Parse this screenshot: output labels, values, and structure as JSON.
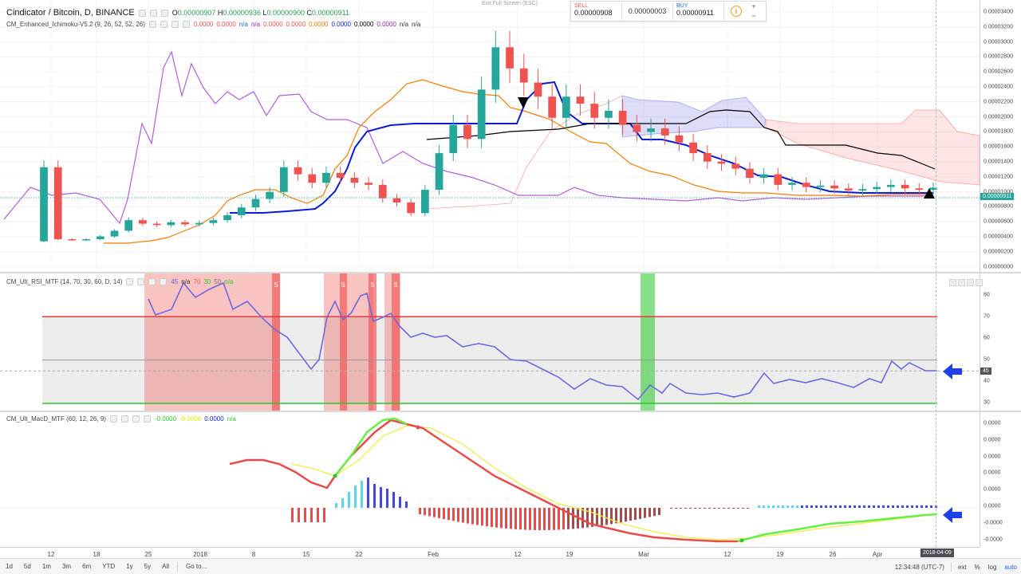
{
  "header": {
    "symbol_title": "Cindicator / Bitcoin, D, BINANCE",
    "open_label": "O",
    "open": "0.00000907",
    "high_label": "H",
    "high": "0.00000936",
    "low_label": "L",
    "low": "0.00000900",
    "close_label": "C",
    "close": "0.00000911",
    "exit_fullscreen": "Exit Full Screen (ESC)"
  },
  "trade_box": {
    "sell_label": "SELL",
    "sell_price": "0.00000908",
    "spread": "0.00000003",
    "buy_label": "BUY",
    "buy_price": "0.00000911",
    "info_icon": "info-icon",
    "plus": "+",
    "minus": "−"
  },
  "indicators": {
    "ichimoku": {
      "name": "CM_Enhanced_Ichimoku-V5.2 (9, 26, 52, 52, 26)",
      "values": [
        {
          "text": "0.0000",
          "color": "#ef5350"
        },
        {
          "text": "0.0000",
          "color": "#ef5350"
        },
        {
          "text": "n/a",
          "color": "#2962ff"
        },
        {
          "text": "n/a",
          "color": "#9c27b0"
        },
        {
          "text": "0.0000",
          "color": "#ef5350"
        },
        {
          "text": "0.0000",
          "color": "#ef5350"
        },
        {
          "text": "0.0000",
          "color": "#f57c00"
        },
        {
          "text": "0.0000",
          "color": "#0d1bd6"
        },
        {
          "text": "0.0000",
          "color": "#000000"
        },
        {
          "text": "0.0000",
          "color": "#9c27b0"
        },
        {
          "text": "n/a",
          "color": "#333333"
        },
        {
          "text": "n/a",
          "color": "#333333"
        }
      ]
    },
    "rsi": {
      "name": "CM_Ult_RSI_MTF (14, 70, 30, 60, D, 14)",
      "values": [
        {
          "text": "45",
          "color": "#5c5ce6"
        },
        {
          "text": "n/a",
          "color": "#333333"
        },
        {
          "text": "70",
          "color": "#ef5350"
        },
        {
          "text": "30",
          "color": "#26c926"
        },
        {
          "text": "50",
          "color": "#777777"
        },
        {
          "text": "n/a",
          "color": "#26c926"
        }
      ],
      "current_value": "45",
      "signal_letter": "S"
    },
    "macd": {
      "name": "CM_Ult_MacD_MTF (60, 12, 26, 9)",
      "values": [
        {
          "text": "-0.0000",
          "color": "#26c926"
        },
        {
          "text": "-0.0000",
          "color": "#e6e600"
        },
        {
          "text": "0.0000",
          "color": "#0d1bd6"
        },
        {
          "text": "n/a",
          "color": "#26c926"
        }
      ]
    }
  },
  "price_axis": {
    "ticks": [
      "0.00003400",
      "0.00003200",
      "0.00003000",
      "0.00002800",
      "0.00002600",
      "0.00002400",
      "0.00002200",
      "0.00002000",
      "0.00001800",
      "0.00001600",
      "0.00001400",
      "0.00001200",
      "0.00001000",
      "0.00000800",
      "0.00000600",
      "0.00000400",
      "0.00000200",
      "0.00000000"
    ],
    "current_price": "0.00000911"
  },
  "rsi_axis": {
    "ticks": [
      "80",
      "70",
      "60",
      "50",
      "40",
      "30"
    ]
  },
  "macd_axis": {
    "ticks": [
      "0.0000",
      "0.0000",
      "0.0000",
      "0.0000",
      "0.0000",
      "0.0000",
      "-0.0000",
      "-0.0000"
    ]
  },
  "time_axis": {
    "ticks": [
      "12",
      "18",
      "25",
      "2018",
      "8",
      "15",
      "22",
      "Feb",
      "12",
      "19",
      "Mar",
      "12",
      "19",
      "26",
      "Apr"
    ],
    "cursor_date": "2018-04-09"
  },
  "bottom_bar": {
    "ranges": [
      "1d",
      "5d",
      "1m",
      "3m",
      "6m",
      "YTD",
      "1y",
      "5y",
      "All"
    ],
    "goto": "Go to...",
    "clock": "12:34:48 (UTC-7)",
    "ext": "ext",
    "percent": "%",
    "log": "log",
    "auto": "auto"
  },
  "colors": {
    "up": "#26a69a",
    "down": "#ef5350",
    "tenkan": "#f57c00",
    "kijun": "#0d1bd6",
    "chikou": "#b05fd9",
    "rsi_line": "#6b6be0",
    "macd_green": "#66ee44",
    "macd_red": "#e84b4b",
    "signal": "#eeee44"
  },
  "chart_data": {
    "type": "candlestick",
    "title": "Cindicator / Bitcoin, D, BINANCE",
    "closes": [
      1.2e-05,
      1.8e-06,
      1.7e-06,
      1.8e-06,
      2.2e-06,
      3e-06,
      4.5e-06,
      4e-06,
      3.8e-06,
      4.2e-06,
      3.9e-06,
      4.1e-06,
      4.5e-06,
      5.2e-06,
      6.3e-06,
      7.5e-06,
      8.5e-06,
      1.2e-05,
      1.1e-05,
      9.8e-06,
      1.12e-05,
      1.05e-05,
      9.8e-06,
      9.5e-06,
      7.6e-06,
      7e-06,
      5.5e-06,
      8.8e-06,
      1.4e-05,
      1.8e-05,
      1.6e-05,
      2.3e-05,
      2.9e-05,
      2.6e-05,
      2.4e-05,
      2.2e-05,
      1.9e-05,
      2.2e-05,
      2.1e-05,
      1.9e-05,
      2e-05,
      1.8e-05,
      1.7e-05,
      1.75e-05,
      1.65e-05,
      1.55e-05,
      1.4e-05,
      1.28e-05,
      1.25e-05,
      1.18e-05,
      1.05e-05,
      1.1e-05,
      9.5e-06,
      9.8e-06,
      9.2e-06,
      9.4e-06,
      9e-06,
      8.7e-06,
      8.9e-06,
      9.2e-06,
      9.5e-06,
      9e-06,
      8.8e-06,
      9.1e-06
    ]
  }
}
